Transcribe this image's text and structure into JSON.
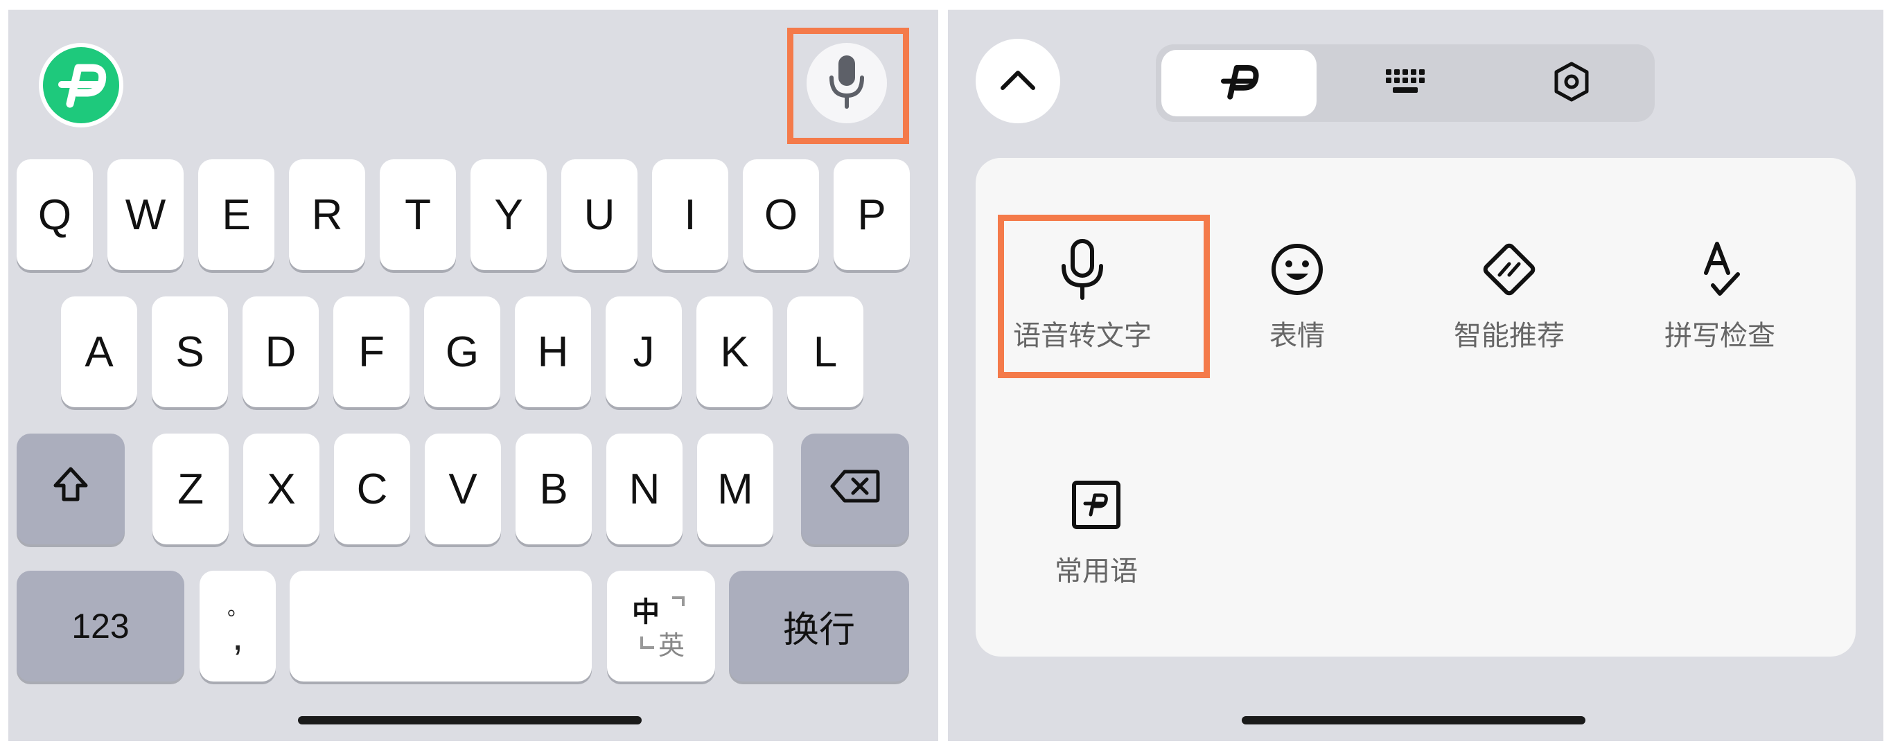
{
  "left_keyboard": {
    "row1": [
      "Q",
      "W",
      "E",
      "R",
      "T",
      "Y",
      "U",
      "I",
      "O",
      "P"
    ],
    "row2": [
      "A",
      "S",
      "D",
      "F",
      "G",
      "H",
      "J",
      "K",
      "L"
    ],
    "row3": [
      "Z",
      "X",
      "C",
      "V",
      "B",
      "N",
      "M"
    ],
    "bottom": {
      "numbers_label": "123",
      "punct_top": "。",
      "punct_bottom": ",",
      "space_label": "",
      "lang_primary": "中",
      "lang_secondary": "英",
      "return_label": "换行"
    },
    "icons": {
      "logo": "app-logo-icon",
      "voice": "microphone-icon",
      "shift": "shift-icon",
      "delete": "backspace-icon"
    }
  },
  "right_panel": {
    "tabs": [
      {
        "icon": "app-logo-icon",
        "active": true
      },
      {
        "icon": "keyboard-icon",
        "active": false
      },
      {
        "icon": "settings-icon",
        "active": false
      }
    ],
    "tools": [
      {
        "label": "语音转文字",
        "icon": "microphone-icon"
      },
      {
        "label": "表情",
        "icon": "smiley-icon"
      },
      {
        "label": "智能推荐",
        "icon": "smart-recommend-icon"
      },
      {
        "label": "拼写检查",
        "icon": "spell-check-icon"
      },
      {
        "label": "常用语",
        "icon": "phrases-icon"
      }
    ]
  },
  "colors": {
    "highlight": "#f47a4a",
    "logo_green": "#1ec97c",
    "keyboard_bg": "#dcdde3",
    "function_key": "#abaebd"
  }
}
